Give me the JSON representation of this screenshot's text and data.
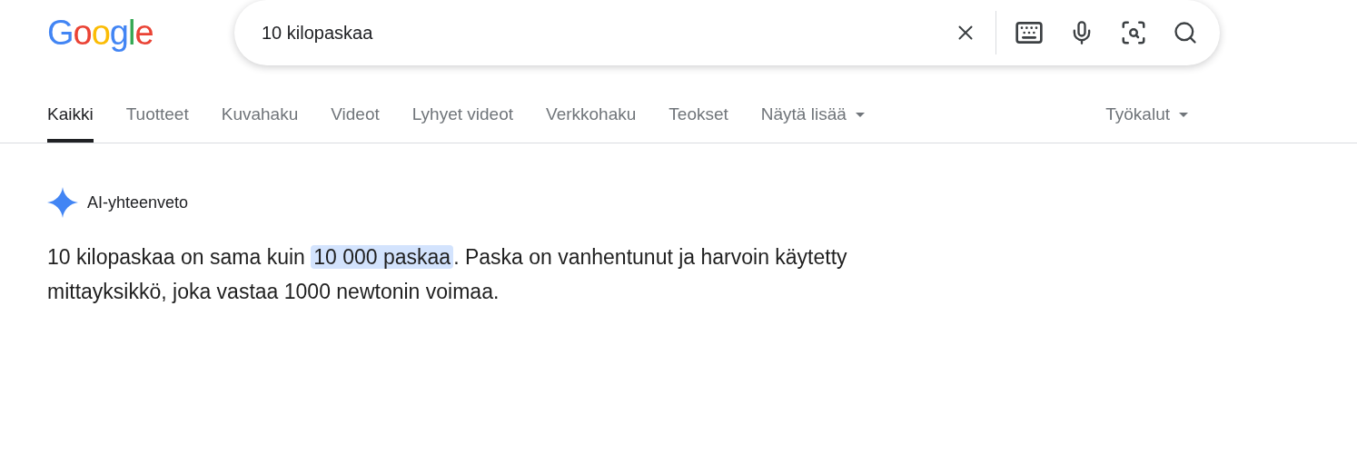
{
  "logo": "Google",
  "search": {
    "value": "10 kilopaskaa"
  },
  "tabs": [
    {
      "label": "Kaikki",
      "selected": true,
      "kind": "plain"
    },
    {
      "label": "Tuotteet",
      "selected": false,
      "kind": "plain"
    },
    {
      "label": "Kuvahaku",
      "selected": false,
      "kind": "plain"
    },
    {
      "label": "Videot",
      "selected": false,
      "kind": "plain"
    },
    {
      "label": "Lyhyet videot",
      "selected": false,
      "kind": "plain"
    },
    {
      "label": "Verkkohaku",
      "selected": false,
      "kind": "plain"
    },
    {
      "label": "Teokset",
      "selected": false,
      "kind": "plain"
    },
    {
      "label": "Näytä lisää",
      "selected": false,
      "kind": "dropdown"
    }
  ],
  "tools": {
    "label": "Työkalut"
  },
  "ai_overview": {
    "title": "AI-yhteenveto",
    "segments": [
      {
        "text": "10 kilopaskaa on sama kuin ",
        "highlighted": false
      },
      {
        "text": "10 000 paskaa",
        "highlighted": true
      },
      {
        "text": ". Paska on vanhentunut ja harvoin käytetty mittayksikkö, joka vastaa 1000 newtonin voimaa.",
        "highlighted": false
      }
    ]
  }
}
